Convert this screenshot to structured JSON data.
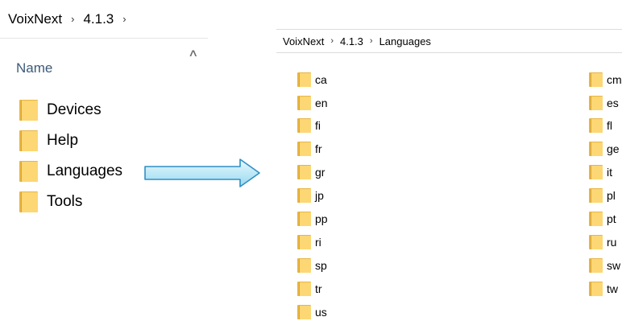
{
  "left_pane": {
    "breadcrumb": [
      "VoixNext",
      "4.1.3"
    ],
    "column_header": "Name",
    "folders": [
      "Devices",
      "Help",
      "Languages",
      "Tools"
    ]
  },
  "right_pane": {
    "breadcrumb": [
      "VoixNext",
      "4.1.3",
      "Languages"
    ],
    "folders_col1": [
      "ca",
      "en",
      "fi",
      "fr",
      "gr",
      "jp",
      "pp",
      "ri",
      "sp",
      "tr",
      "us"
    ],
    "folders_col2": [
      "cm",
      "es",
      "fl",
      "ge",
      "it",
      "pl",
      "pt",
      "ru",
      "sw",
      "tw"
    ]
  },
  "icons": {
    "folder": "folder-icon",
    "chevron": "chevron-right-icon",
    "sort": "sort-ascending-icon",
    "arrow": "right-arrow-icon"
  },
  "colors": {
    "folder_front": "#fcd773",
    "folder_back": "#e7b544",
    "arrow_fill": "#bfe9f7",
    "arrow_stroke": "#2f8fc4",
    "header_text": "#3c5a7a"
  }
}
